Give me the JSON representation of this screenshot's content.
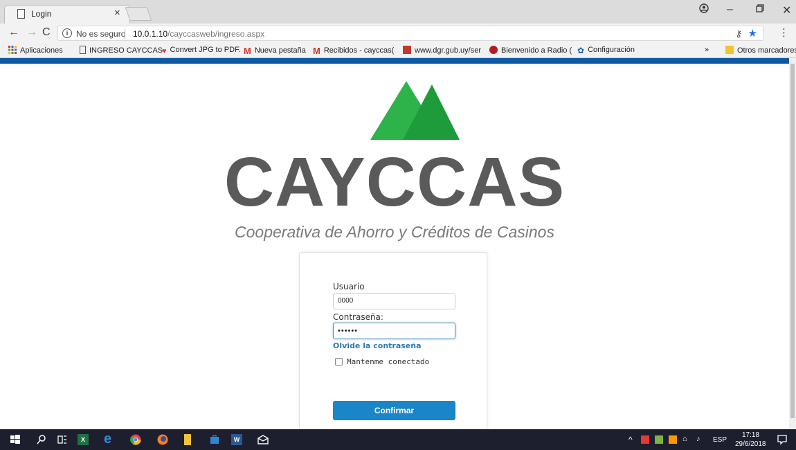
{
  "browser": {
    "tab_title": "Login",
    "address": {
      "security_label": "No es seguro",
      "host": "10.0.1.10",
      "path": "/cayccasweb/ingreso.aspx"
    },
    "bookmarks": [
      {
        "label": "Aplicaciones",
        "icon": "apps-grid-icon"
      },
      {
        "label": "INGRESO CAYCCAS",
        "icon": "page-icon"
      },
      {
        "label": "Convert JPG to PDF.",
        "icon": "heart-icon"
      },
      {
        "label": "Nueva pestaña",
        "icon": "gmail-icon"
      },
      {
        "label": "Recibidos - cayccas(",
        "icon": "gmail-icon"
      },
      {
        "label": "www.dgr.gub.uy/ser",
        "icon": "dgr-icon"
      },
      {
        "label": "Bienvenido a Radio (",
        "icon": "radio-icon"
      },
      {
        "label": "Configuración",
        "icon": "gear-icon"
      }
    ],
    "bookmarks_overflow": "»",
    "other_bookmarks": "Otros marcadores"
  },
  "brand": {
    "name": "CAYCCAS",
    "tagline": "Cooperativa de Ahorro y Créditos de Casinos",
    "colors": {
      "mountain_light": "#2eb34a",
      "mountain_dark": "#1e9c3c",
      "text": "#5a5a5a"
    }
  },
  "login": {
    "user_label": "Usuario",
    "user_value": "0000",
    "password_label": "Contraseña:",
    "password_value": "••••••",
    "forgot_link": "Olvide la contraseña",
    "remember_label": "Mantenme conectado",
    "remember_checked": false,
    "submit_label": "Confirmar",
    "submit_color": "#1a85c7"
  },
  "taskbar": {
    "language": "ESP",
    "time": "17:18",
    "date": "29/6/2018"
  }
}
